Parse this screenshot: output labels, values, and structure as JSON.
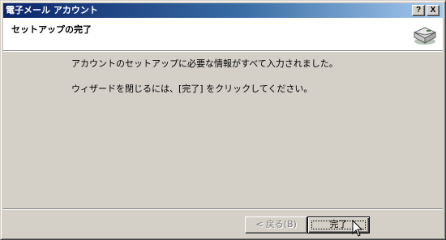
{
  "window": {
    "title": "電子メール アカウント",
    "help_label": "?",
    "close_label": "X"
  },
  "header": {
    "title": "セットアップの完了",
    "icon": "envelope-icon"
  },
  "body": {
    "message1": "アカウントのセットアップに必要な情報がすべて入力されました。",
    "message2": "ウィザードを閉じるには、[完了] をクリックしてください。"
  },
  "buttons": {
    "back_label": "< 戻る(B)",
    "finish_label": "完了"
  },
  "colors": {
    "titlebar_start": "#0a246a",
    "titlebar_end": "#a6caf0",
    "face": "#d4d0c8"
  }
}
